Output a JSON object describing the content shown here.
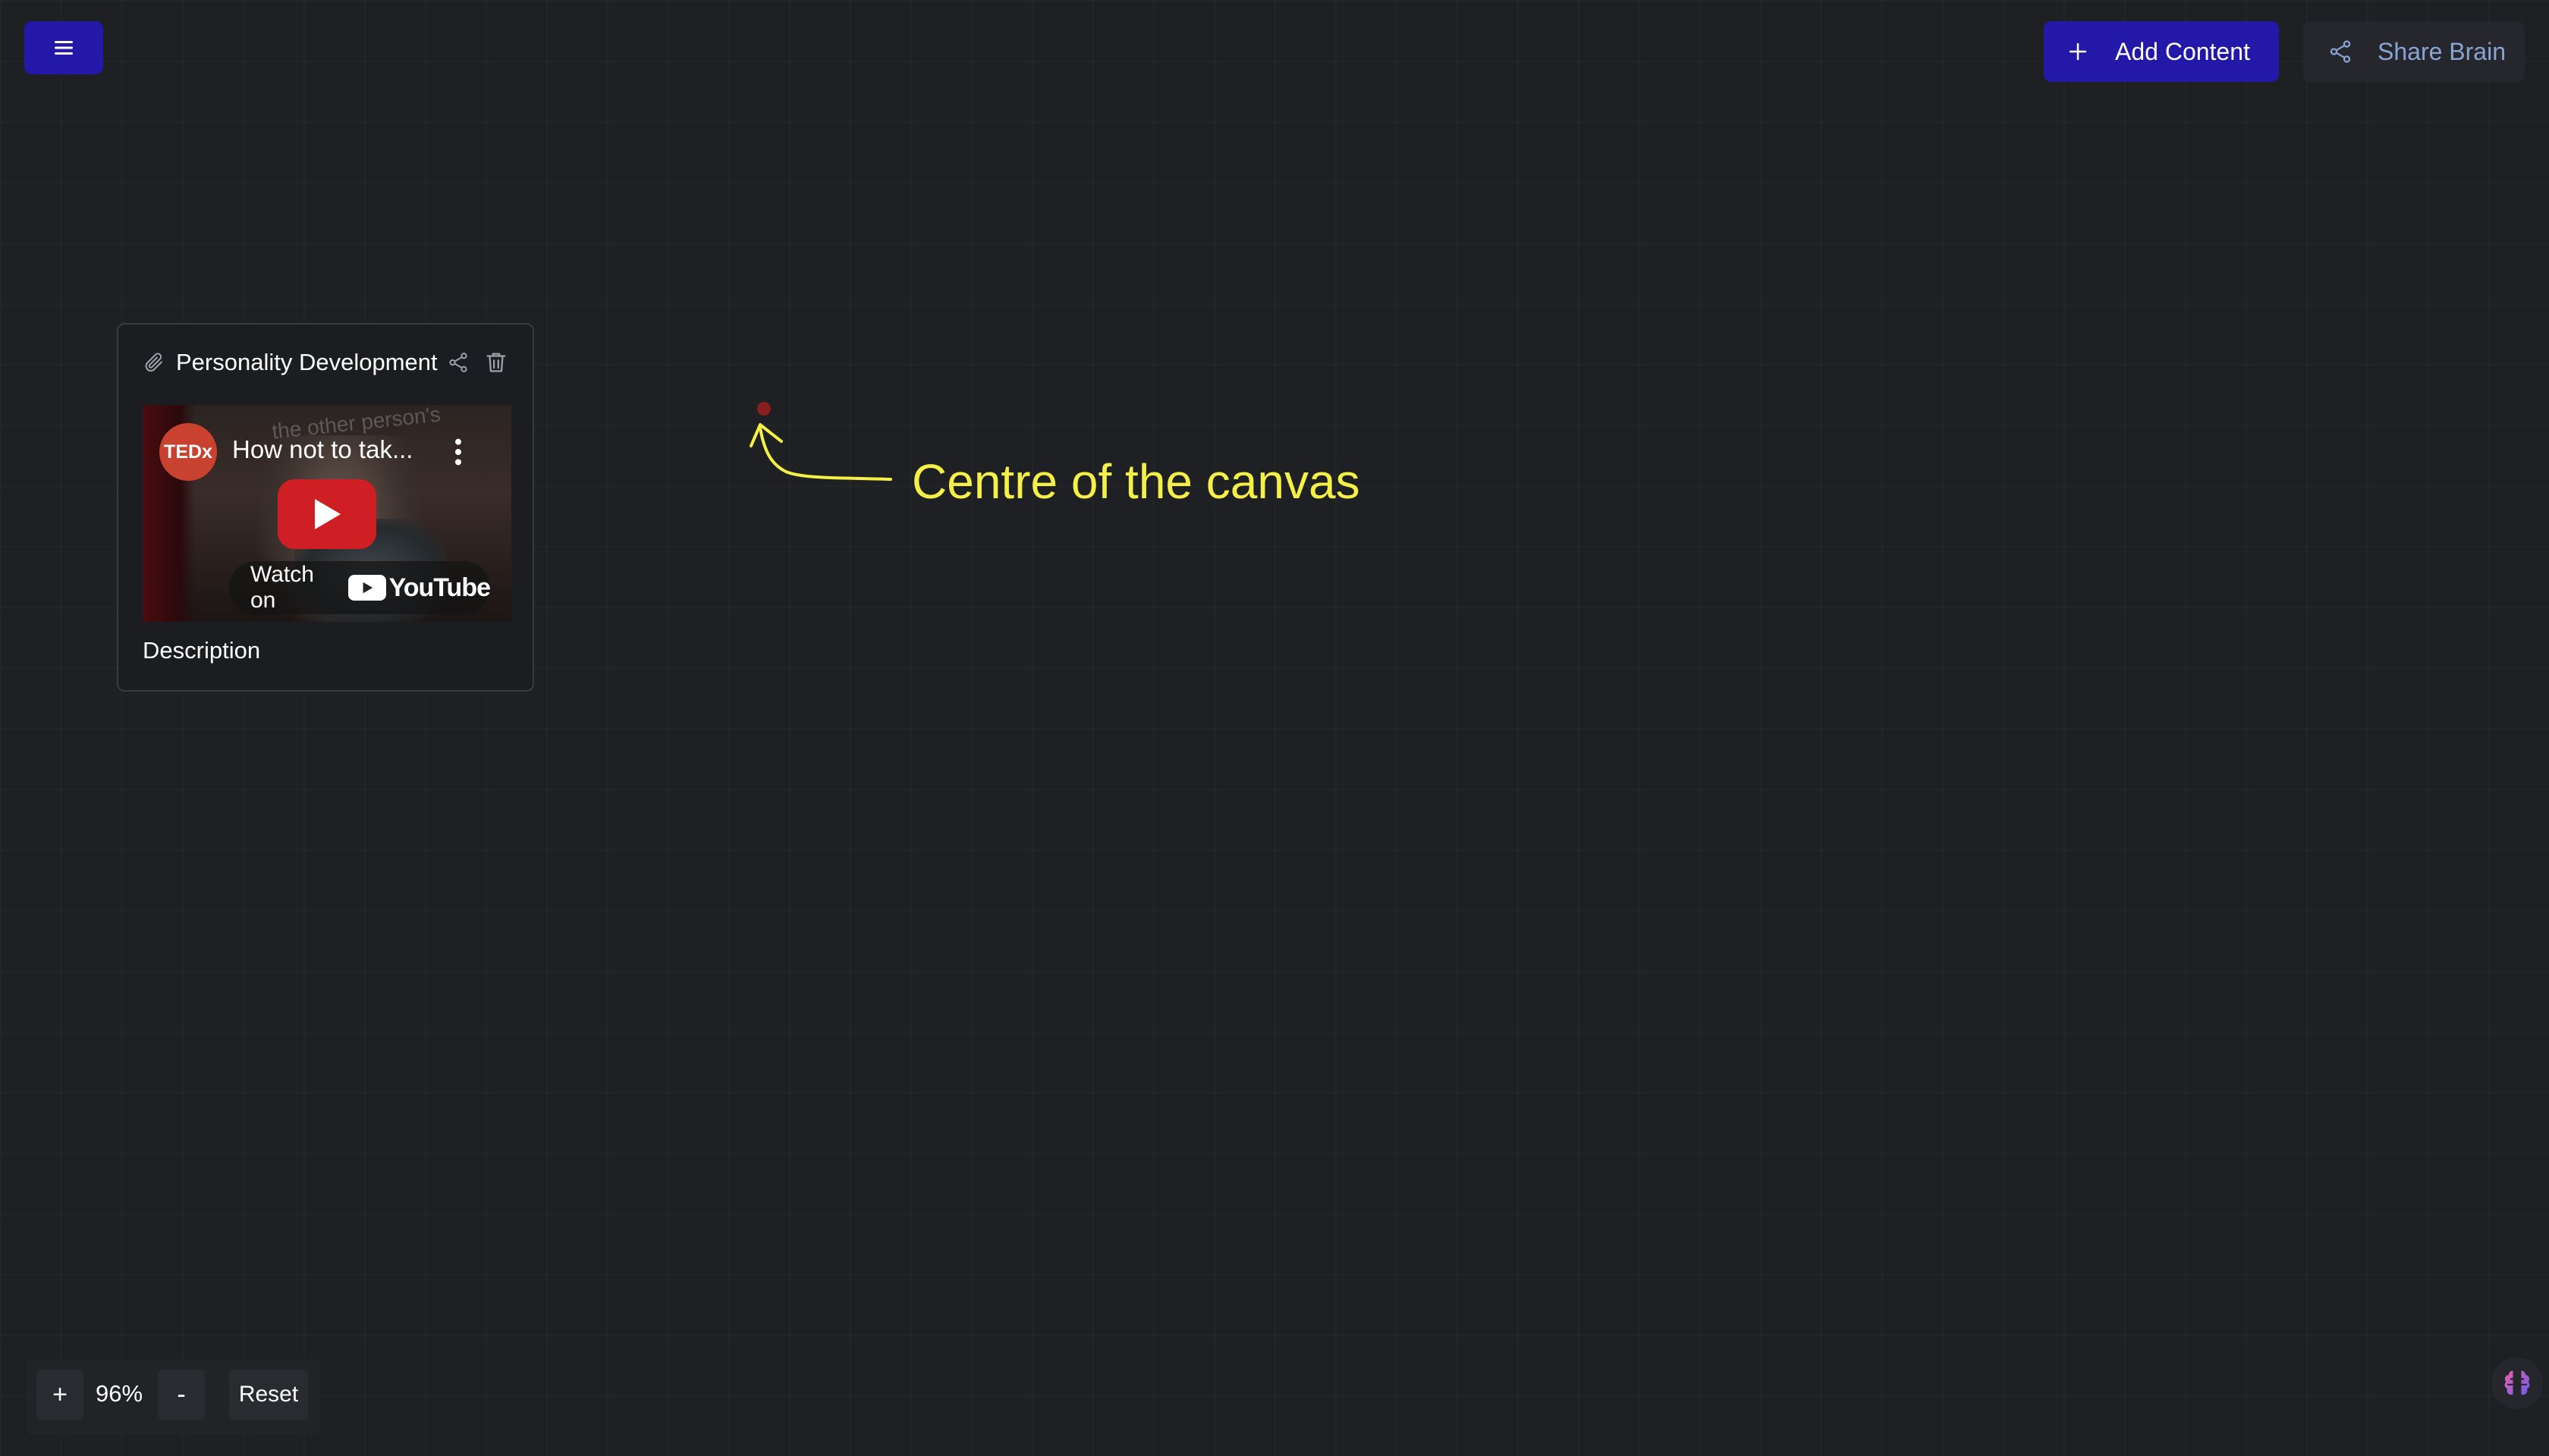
{
  "toolbar": {
    "menu_icon": "hamburger-menu-icon",
    "add_content_label": "Add Content",
    "add_icon": "plus-icon",
    "share_brain_label": "Share Brain",
    "share_icon": "share-icon",
    "accent_color": "#2318a8"
  },
  "card": {
    "title": "Personality Development",
    "title_icon": "paperclip-icon",
    "description": "Description",
    "video": {
      "channel_badge": "TEDx",
      "title": "How not to tak...",
      "overlay_text": "the other person's",
      "watch_label": "Watch on",
      "platform": "YouTube"
    }
  },
  "annotation": {
    "label": "Centre of the canvas",
    "color": "#f4f046"
  },
  "zoom": {
    "plus_label": "+",
    "level": "96%",
    "minus_label": "-",
    "reset_label": "Reset"
  },
  "corner": {
    "icon": "brain-icon"
  }
}
